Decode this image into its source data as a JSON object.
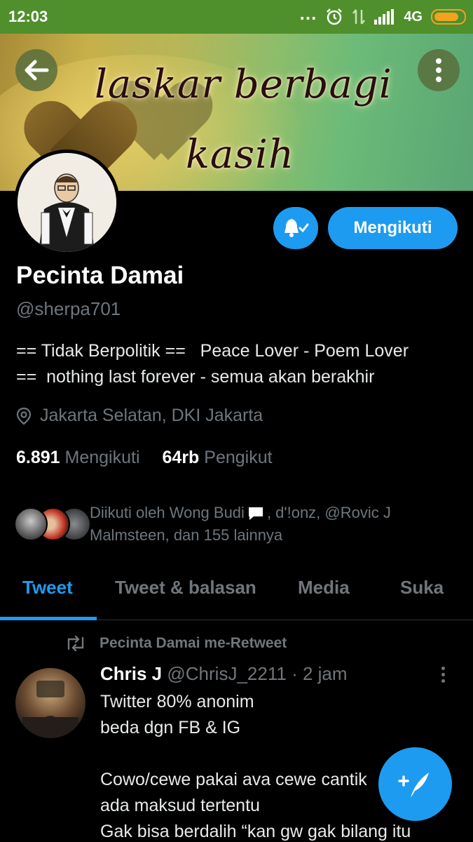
{
  "status_bar": {
    "time": "12:03",
    "dots": "...",
    "network": "4G"
  },
  "header": {
    "banner_line1": "laskar berbagi",
    "banner_line2": "kasih"
  },
  "actions": {
    "follow_label": "Mengikuti"
  },
  "profile": {
    "name": "Pecinta Damai",
    "handle": "@sherpa701",
    "bio": "== Tidak Berpolitik ==   Peace Lover - Poem Lover\n==  nothing last forever - semua akan berakhir",
    "location": "Jakarta Selatan, DKI Jakarta",
    "following_count": "6.891",
    "following_label": "Mengikuti",
    "followers_count": "64rb",
    "followers_label": "Pengikut",
    "followed_by_prefix": "Diikuti oleh Wong Budi",
    "followed_by_suffix": ", d'!onz, @Rovic J Malmsteen, dan 155 lainnya"
  },
  "tabs": [
    {
      "label": "Tweet",
      "active": true
    },
    {
      "label": "Tweet & balasan",
      "active": false
    },
    {
      "label": "Media",
      "active": false
    },
    {
      "label": "Suka",
      "active": false
    }
  ],
  "tweet": {
    "retweet_label": "Pecinta Damai me-Retweet",
    "author_name": "Chris J",
    "author_handle": "@ChrisJ_2211",
    "time": "· 2 jam",
    "text": "Twitter 80% anonim\nbeda dgn FB & IG\n\nCowo/cewe pakai ava cewe cantik\nada maksud tertentu\nGak bisa berdalih “kan gw gak bilang itu"
  },
  "colors": {
    "accent": "#1d9bf0",
    "status_bar": "#4f8f2c",
    "muted": "#6e767d",
    "background": "#000000"
  },
  "icons": [
    "back-arrow-icon",
    "more-vertical-icon",
    "bell-check-icon",
    "location-pin-icon",
    "chat-bubble-icon",
    "retweet-icon",
    "compose-tweet-icon",
    "alarm-icon",
    "battery-icon"
  ]
}
